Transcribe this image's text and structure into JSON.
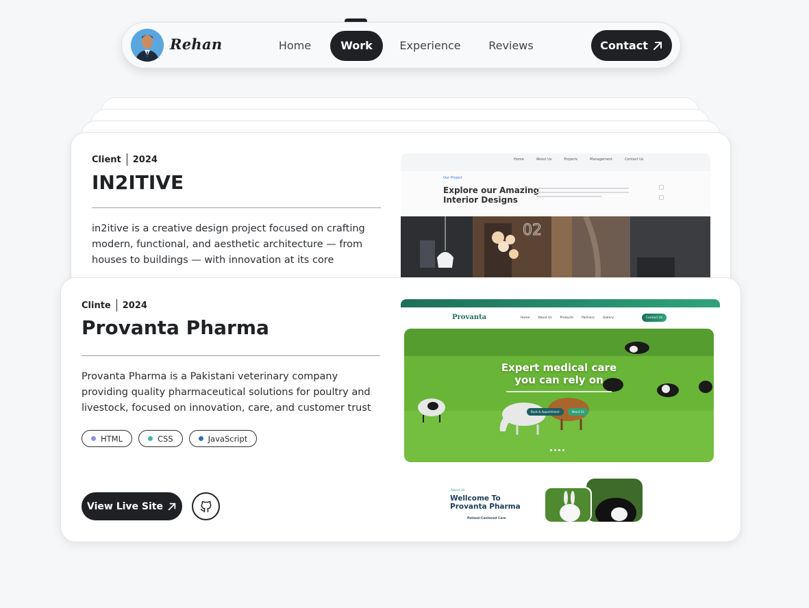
{
  "nav": {
    "brand": "Rehan",
    "links": [
      "Home",
      "Work",
      "Experience",
      "Reviews"
    ],
    "active": "Work",
    "contact_label": "Contact"
  },
  "projects": [
    {
      "client_label": "Client",
      "year": "2024",
      "title": "IN2ITIVE",
      "description": "in2itive is a creative design project focused on crafting modern, functional, and aesthetic architecture — from houses to buildings — with innovation at its core",
      "preview": {
        "nav": [
          "Home",
          "About Us",
          "Projects",
          "Management",
          "Contact Us"
        ],
        "eyebrow": "Our Project",
        "heading_line1": "Explore our Amazing",
        "heading_line2": "Interior Designs",
        "slide_number": "02"
      }
    },
    {
      "client_label": "Clinte",
      "year": "2024",
      "title": "Provanta Pharma",
      "description": "Provanta Pharma is a Pakistani veterinary company providing quality pharmaceutical solutions for poultry and livestock, focused on innovation, care, and customer trust",
      "tags": [
        {
          "label": "HTML",
          "color": "#8b8fe8"
        },
        {
          "label": "CSS",
          "color": "#3bb5a8"
        },
        {
          "label": "JavaScript",
          "color": "#2f6fb5"
        }
      ],
      "live_label": "View Live Site",
      "preview": {
        "logo": "Provanta",
        "nav": [
          "Home",
          "About Us",
          "Products",
          "Partners",
          "Gallery"
        ],
        "contact": "Contact Us",
        "hero_line1": "Expert medical care",
        "hero_line2": "you can rely on",
        "primary_cta": "Book & Appointment",
        "secondary_cta": "About Us",
        "about_eyebrow": "About Us",
        "about_line1": "Wellcome To",
        "about_line2": "Provanta Pharma",
        "about_point": "Patient-Centered Care"
      }
    }
  ],
  "colors": {
    "dark": "#1f2124",
    "accent_teal": "#2fa37c",
    "pharma_green": "#1d6f5a"
  }
}
